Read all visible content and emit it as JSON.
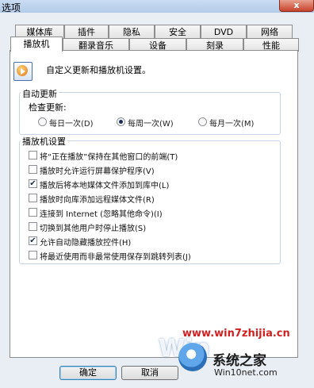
{
  "window": {
    "title": "选项",
    "close_glyph": "x"
  },
  "tabs_row1": [
    "媒体库",
    "插件",
    "隐私",
    "安全",
    "DVD",
    "网络"
  ],
  "tabs_row2": [
    "播放机",
    "翻录音乐",
    "设备",
    "刻录",
    "性能"
  ],
  "active_tab": "播放机",
  "description": "自定义更新和播放机设置。",
  "auto_update": {
    "legend": "自动更新",
    "check_label": "检查更新:",
    "options": [
      {
        "label": "每日一次(D)",
        "selected": false
      },
      {
        "label": "每周一次(W)",
        "selected": true
      },
      {
        "label": "每月一次(M)",
        "selected": false
      }
    ]
  },
  "player_settings": {
    "legend": "播放机设置",
    "options": [
      {
        "label": "将“正在播放”保持在其他窗口的前端(T)",
        "checked": false
      },
      {
        "label": "播放时允许运行屏幕保护程序(V)",
        "checked": false
      },
      {
        "label": "播放后将本地媒体文件添加到库中(L)",
        "checked": true
      },
      {
        "label": "播放时向库添加远程媒体文件(R)",
        "checked": false
      },
      {
        "label": "连接到 Internet (忽略其他命令)(I)",
        "checked": false
      },
      {
        "label": "切换到其他用户时停止播放(S)",
        "checked": false
      },
      {
        "label": "允许自动隐藏播放控件(H)",
        "checked": true
      },
      {
        "label": "将最近使用而非最常使用保存到跳转列表(J)",
        "checked": false
      }
    ]
  },
  "buttons": {
    "ok": "确定",
    "cancel": "取消"
  },
  "watermark": {
    "url": "www.win7zhijia.cn",
    "brand": "系统之家",
    "site": "Win10net.com",
    "win_text": "Win"
  },
  "check_glyph": "✔"
}
